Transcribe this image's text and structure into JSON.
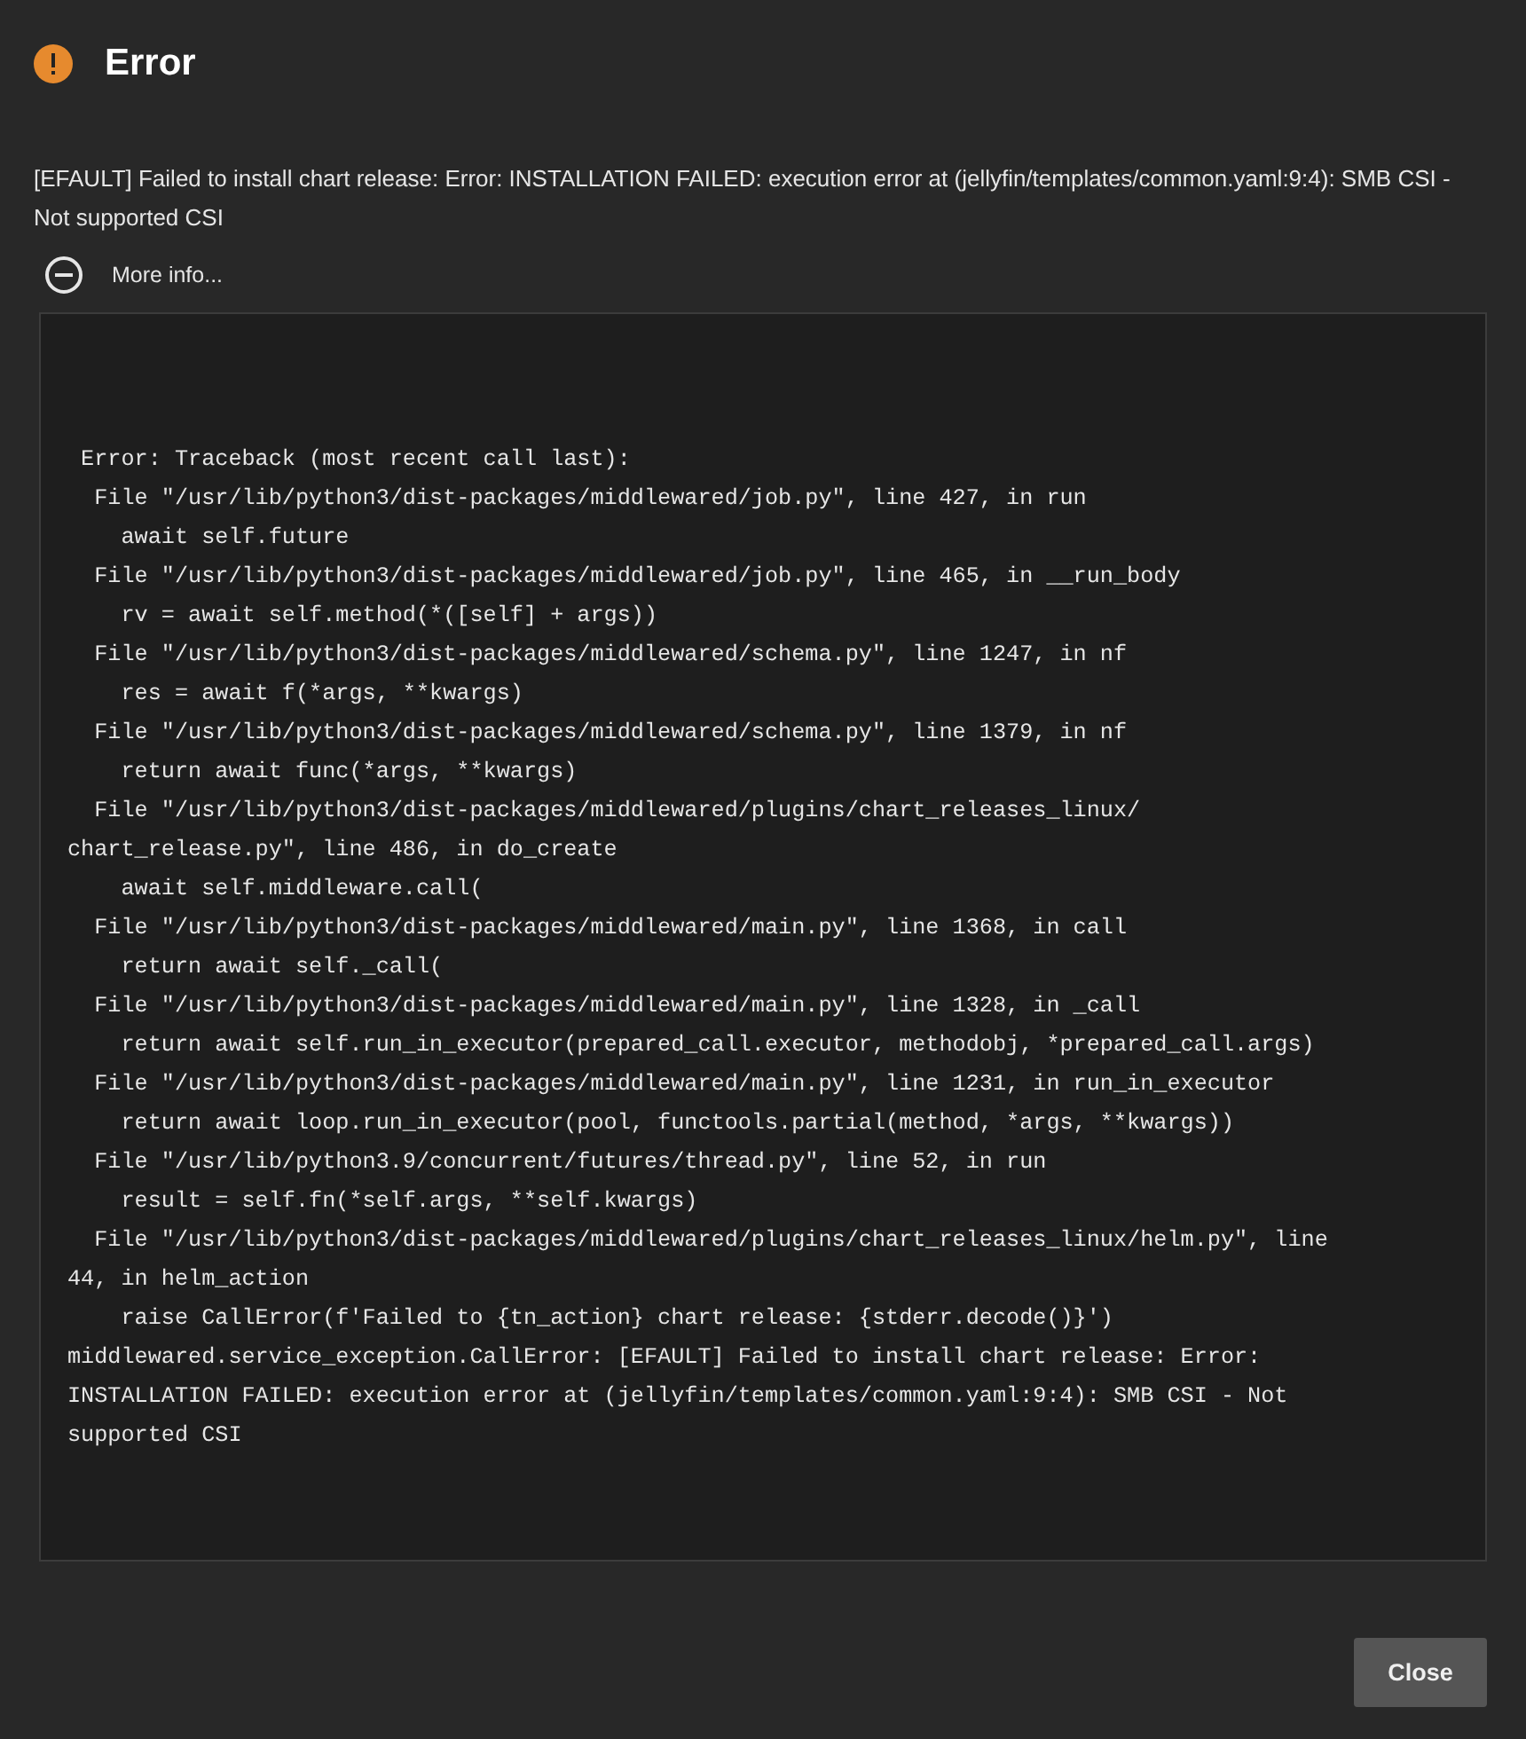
{
  "dialog": {
    "title": "Error",
    "message": "[EFAULT] Failed to install chart release: Error: INSTALLATION FAILED: execution error at (jellyfin/templates/common.yaml:9:4): SMB CSI - Not supported CSI",
    "more_info": {
      "label": "More info...",
      "expanded": true
    },
    "traceback": [
      " Error: Traceback (most recent call last):",
      "  File \"/usr/lib/python3/dist-packages/middlewared/job.py\", line 427, in run",
      "    await self.future",
      "  File \"/usr/lib/python3/dist-packages/middlewared/job.py\", line 465, in __run_body",
      "    rv = await self.method(*([self] + args))",
      "  File \"/usr/lib/python3/dist-packages/middlewared/schema.py\", line 1247, in nf",
      "    res = await f(*args, **kwargs)",
      "  File \"/usr/lib/python3/dist-packages/middlewared/schema.py\", line 1379, in nf",
      "    return await func(*args, **kwargs)",
      "  File \"/usr/lib/python3/dist-packages/middlewared/plugins/chart_releases_linux/",
      "chart_release.py\", line 486, in do_create",
      "    await self.middleware.call(",
      "  File \"/usr/lib/python3/dist-packages/middlewared/main.py\", line 1368, in call",
      "    return await self._call(",
      "  File \"/usr/lib/python3/dist-packages/middlewared/main.py\", line 1328, in _call",
      "    return await self.run_in_executor(prepared_call.executor, methodobj, *prepared_call.args)",
      "  File \"/usr/lib/python3/dist-packages/middlewared/main.py\", line 1231, in run_in_executor",
      "    return await loop.run_in_executor(pool, functools.partial(method, *args, **kwargs))",
      "  File \"/usr/lib/python3.9/concurrent/futures/thread.py\", line 52, in run",
      "    result = self.fn(*self.args, **self.kwargs)",
      "  File \"/usr/lib/python3/dist-packages/middlewared/plugins/chart_releases_linux/helm.py\", line",
      "44, in helm_action",
      "    raise CallError(f'Failed to {tn_action} chart release: {stderr.decode()}')",
      "middlewared.service_exception.CallError: [EFAULT] Failed to install chart release: Error:",
      "INSTALLATION FAILED: execution error at (jellyfin/templates/common.yaml:9:4): SMB CSI - Not",
      "supported CSI"
    ],
    "buttons": [
      "Close"
    ]
  }
}
